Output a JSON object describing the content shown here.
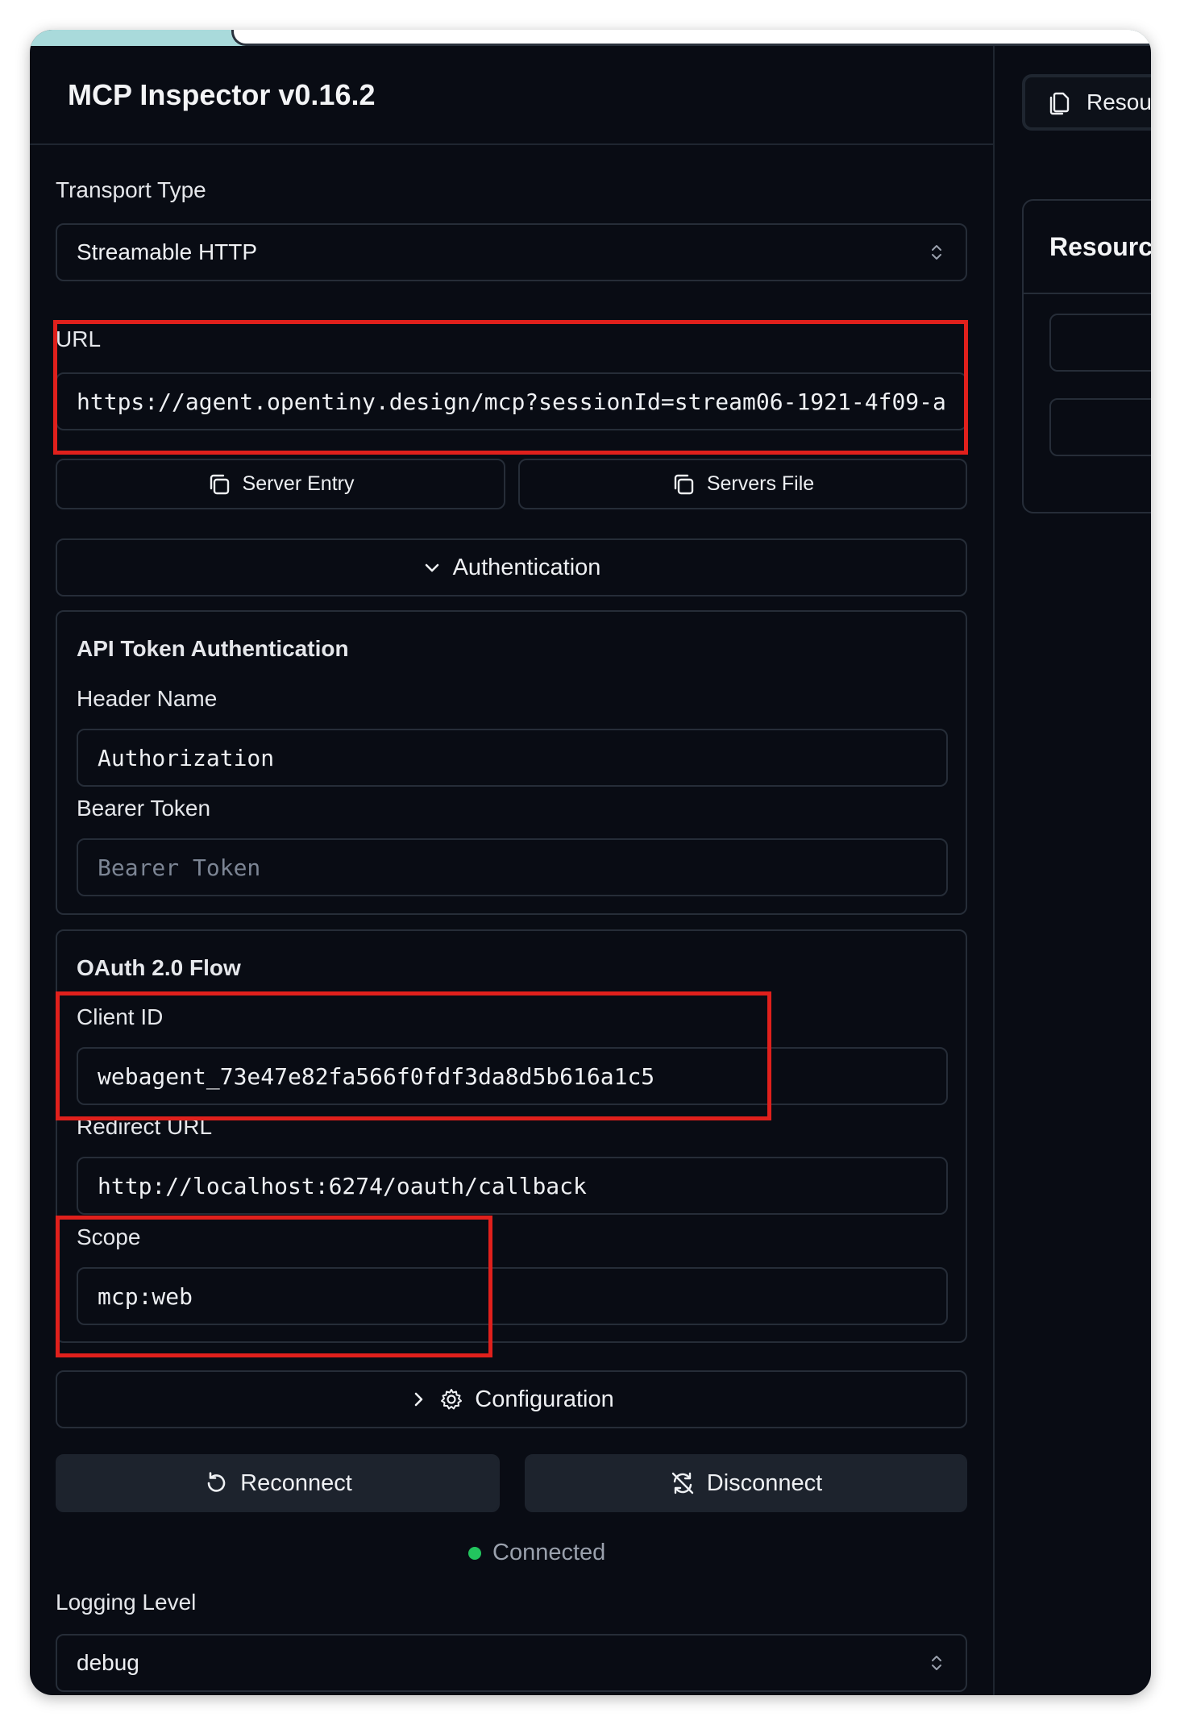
{
  "app": {
    "title": "MCP Inspector v0.16.2"
  },
  "transport": {
    "label": "Transport Type",
    "value": "Streamable HTTP"
  },
  "url": {
    "label": "URL",
    "value": "https://agent.opentiny.design/mcp?sessionId=stream06-1921-4f09-a"
  },
  "copy_buttons": {
    "server_entry": "Server Entry",
    "servers_file": "Servers File"
  },
  "auth": {
    "toggle_label": "Authentication",
    "api_token": {
      "title": "API Token Authentication",
      "header_name_label": "Header Name",
      "header_name_value": "Authorization",
      "bearer_label": "Bearer Token",
      "bearer_placeholder": "Bearer Token"
    },
    "oauth": {
      "title": "OAuth 2.0 Flow",
      "client_id_label": "Client ID",
      "client_id_value": "webagent_73e47e82fa566f0fdf3da8d5b616a1c5",
      "redirect_label": "Redirect URL",
      "redirect_value": "http://localhost:6274/oauth/callback",
      "scope_label": "Scope",
      "scope_value": "mcp:web"
    }
  },
  "configuration": {
    "label": "Configuration"
  },
  "connection": {
    "reconnect_label": "Reconnect",
    "disconnect_label": "Disconnect",
    "status": "Connected",
    "status_color": "#22c55e"
  },
  "logging": {
    "label": "Logging Level",
    "value": "debug"
  },
  "right_pane": {
    "tab_label": "Resou",
    "card_title": "Resourc"
  },
  "highlight_color": "#e0201c"
}
